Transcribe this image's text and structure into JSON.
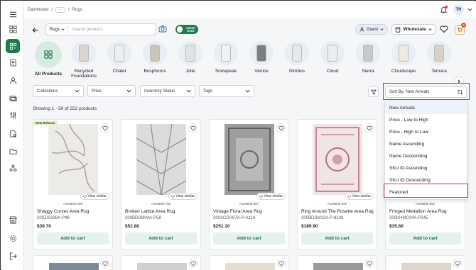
{
  "breadcrumb": {
    "items": [
      "Dashboard",
      "Rugs"
    ],
    "more": "···"
  },
  "user": {
    "initials": "TH"
  },
  "search": {
    "category": "Rugs",
    "placeholder": "Search products"
  },
  "order_mode": {
    "label": "ORDER MODE"
  },
  "guest": {
    "label": "Guest"
  },
  "price_tier": {
    "label": "Wholesale"
  },
  "cart": {
    "count": "6"
  },
  "categories": [
    {
      "label": "All Products",
      "active": true
    },
    {
      "label": "Recycled Foundations"
    },
    {
      "label": "Chalet"
    },
    {
      "label": "Bosphorus"
    },
    {
      "label": "Jolie"
    },
    {
      "label": "Snowpeak"
    },
    {
      "label": "Venice"
    },
    {
      "label": "Nimbus"
    },
    {
      "label": "Cloud"
    },
    {
      "label": "Sierra"
    },
    {
      "label": "Cloudscape"
    },
    {
      "label": "Temara"
    }
  ],
  "filters": {
    "collections": "Collections",
    "price": "Price",
    "inventory": "Inventory Status",
    "tags": "Tags",
    "sort": "Sort By: New Arrivals"
  },
  "showing": "Showing 1 - 50 of 252 products",
  "products": [
    {
      "badge": "New Release",
      "view_similar": "View similar",
      "available": "Available:699",
      "name": "Shaggy Curves Area Rug",
      "sku": "200ZSG08A-P49",
      "price": "$39.70",
      "cta": "Add to cart"
    },
    {
      "view_similar": "View similar",
      "available": "Available:756",
      "name": "Broken Lattice Area Rug",
      "sku": "200BDSM04A-P58",
      "price": "$52.80",
      "cta": "Add to cart"
    },
    {
      "view_similar": "View similar",
      "available": "Available:587",
      "name": "Vintage Floral Area Rug",
      "sku": "200ACCH07A-P-A114",
      "price": "$251.10",
      "cta": "Add to cart"
    },
    {
      "view_similar": "View similar",
      "available": "Available:468",
      "name": "Ring Around The Rosette Area Rug",
      "sku": "200BDSM12A-P-8108",
      "price": "$189.90",
      "cta": "Add to cart"
    },
    {
      "available": "Available:552",
      "name": "Fringed Medallion Area Rug",
      "sku": "200KHMC04A-P245",
      "price": "$35.60",
      "cta": "Add to cart"
    }
  ],
  "sort_options": [
    "New Arrivals",
    "Price - Low to High",
    "Price - High to Low",
    "Name Ascending",
    "Name Descending",
    "SKU ID Ascending",
    "SKU ID Descending",
    "Featured"
  ],
  "colors": {
    "brand_green": "#1f7a4d",
    "highlight_red": "#e0362c"
  }
}
